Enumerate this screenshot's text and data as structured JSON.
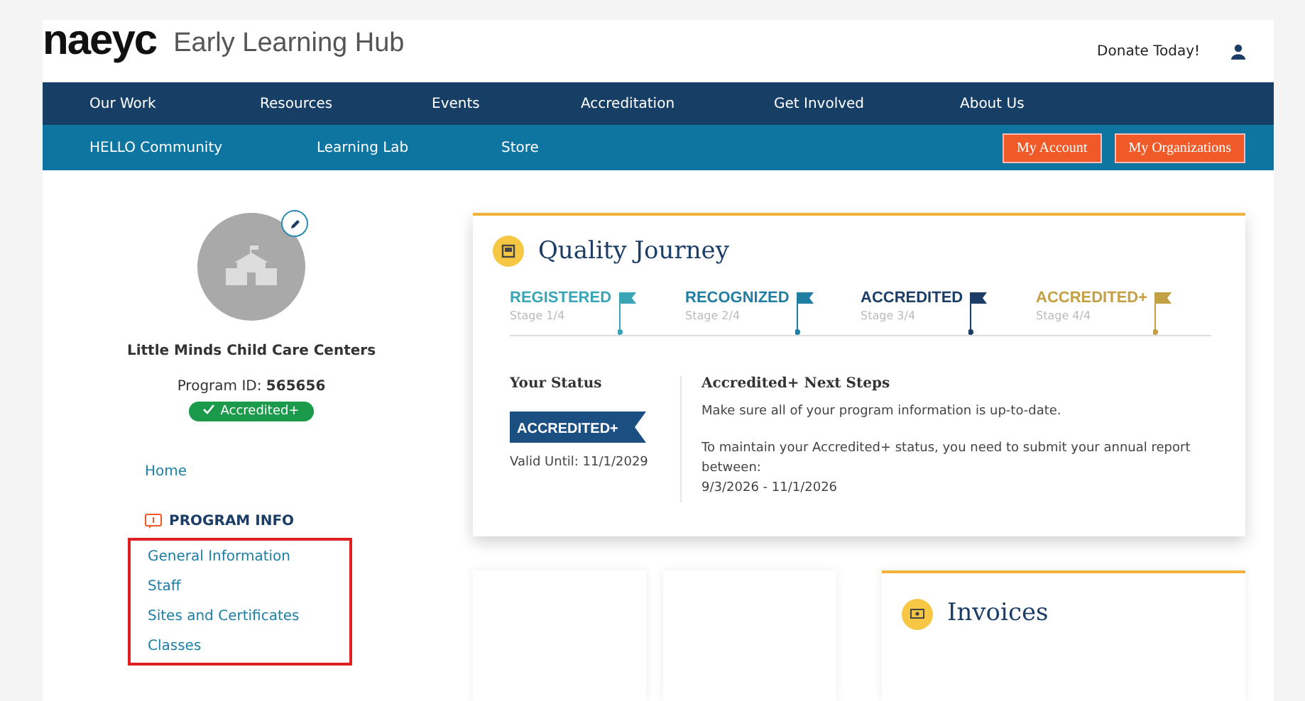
{
  "header": {
    "logo": "naeyc",
    "title": "Early Learning Hub",
    "donate": "Donate Today!"
  },
  "main_nav": [
    "Our Work",
    "Resources",
    "Events",
    "Accreditation",
    "Get Involved",
    "About Us"
  ],
  "sub_nav": {
    "links": [
      "HELLO Community",
      "Learning Lab",
      "Store"
    ],
    "buttons": [
      "My Account",
      "My Organizations"
    ]
  },
  "program": {
    "name": "Little Minds Child Care Centers",
    "id_label": "Program ID:",
    "id": "565656",
    "badge": "Accredited+"
  },
  "sidebar": {
    "home": "Home",
    "section": "PROGRAM INFO",
    "highlighted": true,
    "items": [
      "General Information",
      "Staff",
      "Sites and Certificates",
      "Classes"
    ]
  },
  "quality_journey": {
    "title": "Quality Journey",
    "stages": [
      {
        "name": "REGISTERED",
        "stage": "Stage 1/4",
        "color": "#3aa5b5"
      },
      {
        "name": "RECOGNIZED",
        "stage": "Stage 2/4",
        "color": "#1f7ea1"
      },
      {
        "name": "ACCREDITED",
        "stage": "Stage 3/4",
        "color": "#1b3d66"
      },
      {
        "name": "ACCREDITED+",
        "stage": "Stage 4/4",
        "color": "#c4a045"
      }
    ],
    "status_title": "Your Status",
    "status_banner": "ACCREDITED+",
    "valid_until": "Valid Until: 11/1/2029",
    "steps_title": "Accredited+ Next Steps",
    "steps": [
      "Make sure all of your program information is up-to-date.",
      "To maintain your Accredited+ status, you need to submit your annual report between:\n9/3/2026 - 11/1/2026"
    ]
  },
  "invoices": {
    "title": "Invoices"
  }
}
